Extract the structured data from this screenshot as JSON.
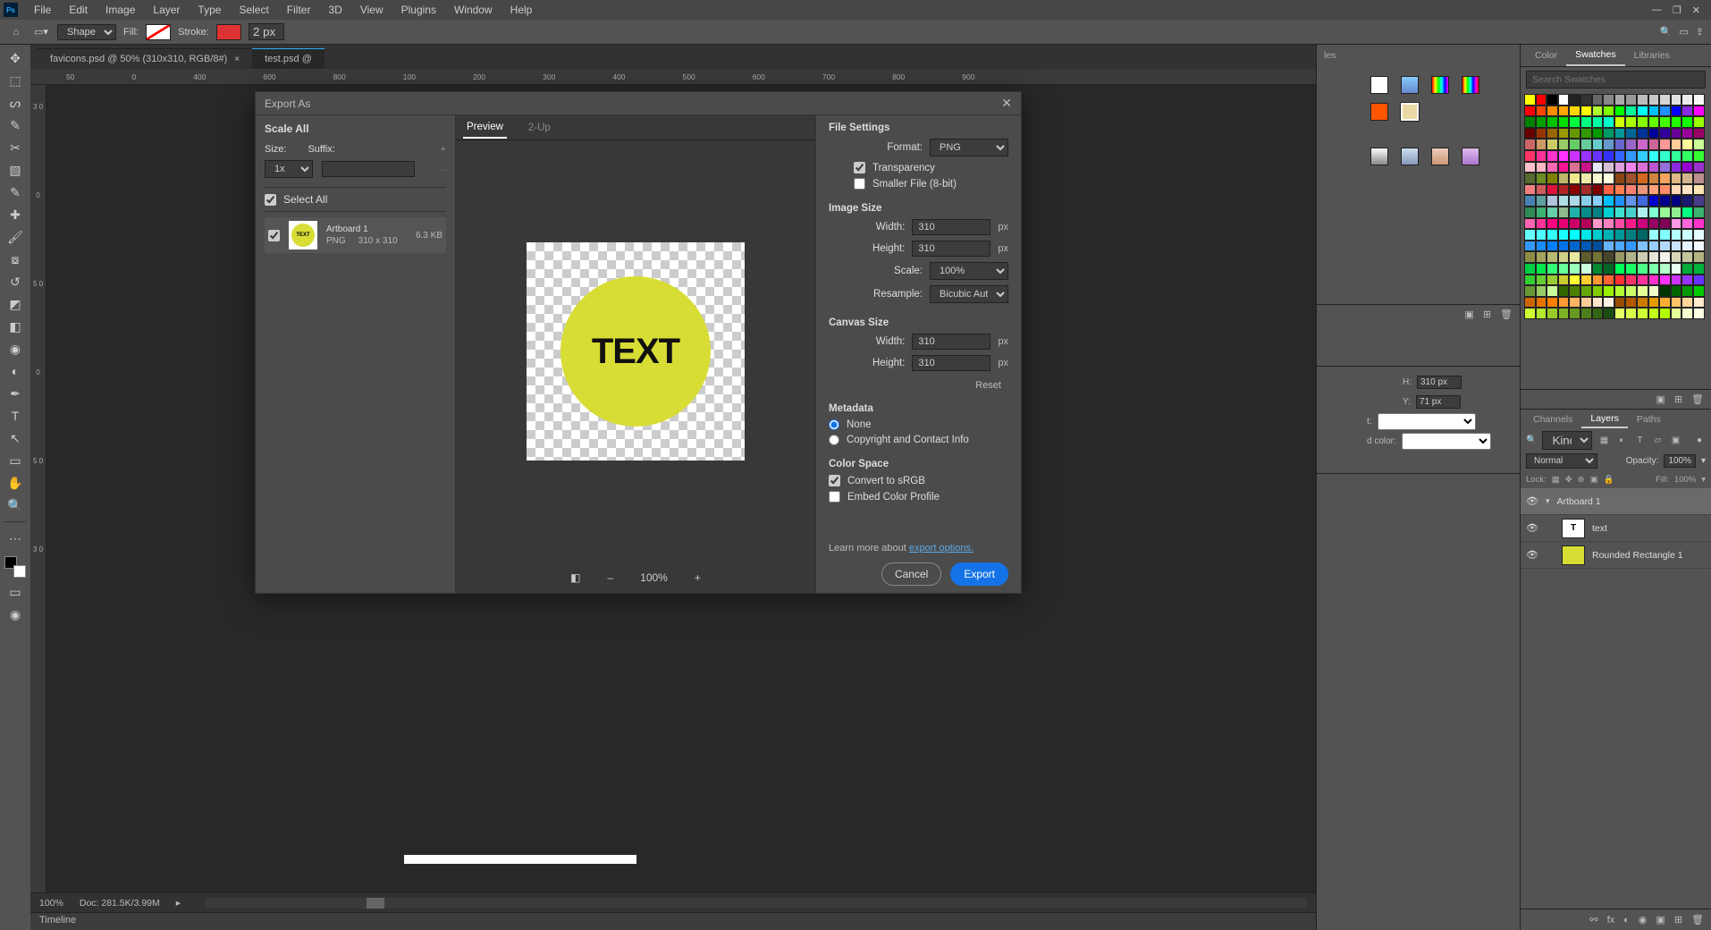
{
  "menu": {
    "items": [
      "File",
      "Edit",
      "Image",
      "Layer",
      "Type",
      "Select",
      "Filter",
      "3D",
      "View",
      "Plugins",
      "Window",
      "Help"
    ]
  },
  "optbar": {
    "shape": "Shape",
    "fill": "Fill:",
    "stroke": "Stroke:",
    "strokeval": "2 px"
  },
  "docktabs": {
    "tab0": "favicons.psd @ 50% (310x310, RGB/8#)",
    "tab1": "test.psd @ "
  },
  "ruler_h": [
    "50",
    "0",
    "400",
    "600",
    "800",
    "100",
    "200",
    "300",
    "400",
    "500",
    "600",
    "700",
    "800",
    "900",
    "",
    ""
  ],
  "ruler_v": [
    "3 0",
    "0",
    "5 0",
    "0",
    "5 0",
    "3 0"
  ],
  "status": {
    "zoom": "100%",
    "doc": "Doc: 281.5K/3.99M"
  },
  "timeline": {
    "label": "Timeline"
  },
  "rightpanel": {
    "h_label": "H:",
    "h_val": "310 px",
    "y_label": "Y:",
    "y_val": "71 px",
    "t_label": "t:",
    "dcolor_label": "d color:"
  },
  "swatches_tabs": {
    "color": "Color",
    "swatches": "Swatches",
    "libraries": "Libraries"
  },
  "swatches_search": "Search Swatches",
  "layers_tabs": {
    "channels": "Channels",
    "layers": "Layers",
    "paths": "Paths"
  },
  "layers_kind": "Kind",
  "layers_blend": "Normal",
  "layers_opacity_label": "Opacity:",
  "layers_opacity_val": "100%",
  "layers_lock": "Lock:",
  "layers_fill_label": "Fill:",
  "layers_fill_val": "100%",
  "layers": {
    "l0": "Artboard 1",
    "l1": "text",
    "l2": "Rounded Rectangle 1"
  },
  "modal": {
    "title": "Export As",
    "scale_all": "Scale All",
    "size_lbl": "Size:",
    "suffix_lbl": "Suffix:",
    "size_val": "1x",
    "select_all": "Select All",
    "art_name": "Artboard 1",
    "art_fmt": "PNG",
    "art_dims": "310 x 310",
    "art_filesize": "6.3 KB",
    "tabs": {
      "preview": "Preview",
      "twoup": "2-Up"
    },
    "preview_text": "TEXT",
    "zoom": "100%",
    "file_settings": "File Settings",
    "format_lbl": "Format:",
    "format_val": "PNG",
    "transparency": "Transparency",
    "smaller": "Smaller File (8-bit)",
    "image_size": "Image Size",
    "width_lbl": "Width:",
    "width_val": "310",
    "px": "px",
    "height_lbl": "Height:",
    "height_val": "310",
    "scale_lbl": "Scale:",
    "scale_val": "100%",
    "resample_lbl": "Resample:",
    "resample_val": "Bicubic Auto...",
    "canvas_size": "Canvas Size",
    "cw_val": "310",
    "ch_val": "310",
    "reset": "Reset",
    "metadata": "Metadata",
    "meta_none": "None",
    "meta_copy": "Copyright and Contact Info",
    "color_space": "Color Space",
    "convert_srgb": "Convert to sRGB",
    "embed": "Embed Color Profile",
    "learn": "Learn more about ",
    "learn_link": "export options.",
    "cancel": "Cancel",
    "export": "Export"
  },
  "swcolors": [
    "#ffff00",
    "#ff0000",
    "#000000",
    "#ffffff",
    "#222222",
    "#333333",
    "#666666",
    "#888888",
    "#aaaaaa",
    "#999999",
    "#bcbcbc",
    "#c8c8c8",
    "#d4d4d4",
    "#e0e0e0",
    "#ececec",
    "#f7f7f7",
    "#ff0000",
    "#ff4500",
    "#ff8c00",
    "#ffa500",
    "#ffd700",
    "#ffff00",
    "#adff2f",
    "#7fff00",
    "#00ff00",
    "#00fa9a",
    "#00ffff",
    "#00bfff",
    "#1e90ff",
    "#0000ff",
    "#8a2be2",
    "#ff00ff",
    "#008000",
    "#00a000",
    "#00c000",
    "#00e000",
    "#00ff40",
    "#00ff80",
    "#00ffa0",
    "#00ffcc",
    "#ccff00",
    "#aaff00",
    "#88ff00",
    "#66ff00",
    "#44ff00",
    "#22ff00",
    "#11ff00",
    "#99ff00",
    "#660000",
    "#993300",
    "#996600",
    "#999900",
    "#669900",
    "#339900",
    "#009900",
    "#009966",
    "#009999",
    "#006699",
    "#003399",
    "#000099",
    "#330099",
    "#660099",
    "#990099",
    "#990066",
    "#cc6666",
    "#cc9966",
    "#cccc66",
    "#99cc66",
    "#66cc66",
    "#66cc99",
    "#66cccc",
    "#6699cc",
    "#6666cc",
    "#9966cc",
    "#cc66cc",
    "#cc6699",
    "#ff9999",
    "#ffcc99",
    "#ffff99",
    "#ccff99",
    "#ff3366",
    "#ff3399",
    "#ff33cc",
    "#ff33ff",
    "#cc33ff",
    "#9933ff",
    "#6633ff",
    "#3333ff",
    "#3366ff",
    "#3399ff",
    "#33ccff",
    "#33ffff",
    "#33ffcc",
    "#33ff99",
    "#33ff66",
    "#33ff33",
    "#ffc0cb",
    "#ffb6c1",
    "#ff69b4",
    "#ff1493",
    "#db7093",
    "#c71585",
    "#e6e6fa",
    "#d8bfd8",
    "#dda0dd",
    "#ee82ee",
    "#da70d6",
    "#ba55d3",
    "#9370db",
    "#8a2be2",
    "#9400d3",
    "#9932cc",
    "#556b2f",
    "#6b8e23",
    "#808000",
    "#bdb76b",
    "#f0e68c",
    "#eee8aa",
    "#fafad2",
    "#ffffe0",
    "#8b4513",
    "#a0522d",
    "#d2691e",
    "#cd853f",
    "#f4a460",
    "#deb887",
    "#d2b48c",
    "#bc8f8f",
    "#f08080",
    "#cd5c5c",
    "#dc143c",
    "#b22222",
    "#8b0000",
    "#a52a2a",
    "#800000",
    "#ff6347",
    "#ff7f50",
    "#fa8072",
    "#e9967a",
    "#ffa07a",
    "#ff8c69",
    "#ffdab9",
    "#ffe4c4",
    "#ffe4b5",
    "#4682b4",
    "#5f9ea0",
    "#b0c4de",
    "#b0e0e6",
    "#add8e6",
    "#87ceeb",
    "#87cefa",
    "#00bfff",
    "#1e90ff",
    "#6495ed",
    "#4169e1",
    "#0000cd",
    "#00008b",
    "#000080",
    "#191970",
    "#483d8b",
    "#2e8b57",
    "#3cb371",
    "#66cdaa",
    "#8fbc8f",
    "#20b2aa",
    "#008b8b",
    "#008080",
    "#00ced1",
    "#40e0d0",
    "#48d1cc",
    "#afeeee",
    "#7fffd4",
    "#98fb98",
    "#90ee90",
    "#00ff7f",
    "#3cb371",
    "#ff66b2",
    "#ff3399",
    "#ff0080",
    "#e60073",
    "#cc0066",
    "#b30059",
    "#ff99cc",
    "#ff80bf",
    "#ff4da6",
    "#ff1a8c",
    "#cc007a",
    "#990066",
    "#800055",
    "#ff99e6",
    "#ff66d9",
    "#ff33cc",
    "#66ffff",
    "#4dffff",
    "#33ffff",
    "#1affff",
    "#00ffff",
    "#00e5e5",
    "#00cccc",
    "#00b2b2",
    "#009999",
    "#008080",
    "#006666",
    "#99ffff",
    "#80ffff",
    "#b3ffff",
    "#ccffff",
    "#e5ffff",
    "#3399ff",
    "#1a8cff",
    "#007fff",
    "#0073e6",
    "#0066cc",
    "#0059b2",
    "#004d99",
    "#66b2ff",
    "#4da6ff",
    "#3399ff",
    "#80bfff",
    "#99ccff",
    "#b3d9ff",
    "#cce5ff",
    "#e5f2ff",
    "#f2f8ff",
    "#8c8c46",
    "#a3a35c",
    "#b9b973",
    "#d0d089",
    "#e6e6a0",
    "#5c5c2e",
    "#737339",
    "#46462e",
    "#999966",
    "#b2b28c",
    "#ccccb2",
    "#e5e5d8",
    "#f2f2ea",
    "#d8d8b8",
    "#c6c69e",
    "#b4b485",
    "#00cc44",
    "#00e64d",
    "#33ff77",
    "#66ff99",
    "#99ffbb",
    "#ccffdd",
    "#008833",
    "#006626",
    "#00ff55",
    "#1aff66",
    "#4dff88",
    "#80ffaa",
    "#b3ffcc",
    "#e6ffee",
    "#00aa3b",
    "#00b33c",
    "#33cc33",
    "#66cc33",
    "#99cc33",
    "#cccc33",
    "#ffff33",
    "#ffcc33",
    "#ff9933",
    "#ff6633",
    "#ff3333",
    "#ff3366",
    "#ff3399",
    "#ff33cc",
    "#ff33ff",
    "#cc33ff",
    "#9933ff",
    "#6633ff",
    "#669933",
    "#99cc66",
    "#ccff99",
    "#336600",
    "#4d8000",
    "#66a600",
    "#80cc00",
    "#99f200",
    "#b3ff33",
    "#ccff66",
    "#e5ff99",
    "#f2ffcc",
    "#003300",
    "#006600",
    "#009900",
    "#00cc00",
    "#cc6600",
    "#e67300",
    "#ff8000",
    "#ff9933",
    "#ffb366",
    "#ffcc99",
    "#ffe5cc",
    "#fff2e5",
    "#994d00",
    "#b35900",
    "#cc7a00",
    "#e59900",
    "#ffad33",
    "#ffc266",
    "#ffd699",
    "#ffeacc",
    "#ccff33",
    "#b3e62e",
    "#99cc29",
    "#80b324",
    "#66991f",
    "#4d801a",
    "#336614",
    "#1a4d0f",
    "#e5ff66",
    "#d9ff4d",
    "#ccff33",
    "#bfff1a",
    "#b3ff00",
    "#e6ff99",
    "#f2ffcc",
    "#f9ffe5"
  ]
}
